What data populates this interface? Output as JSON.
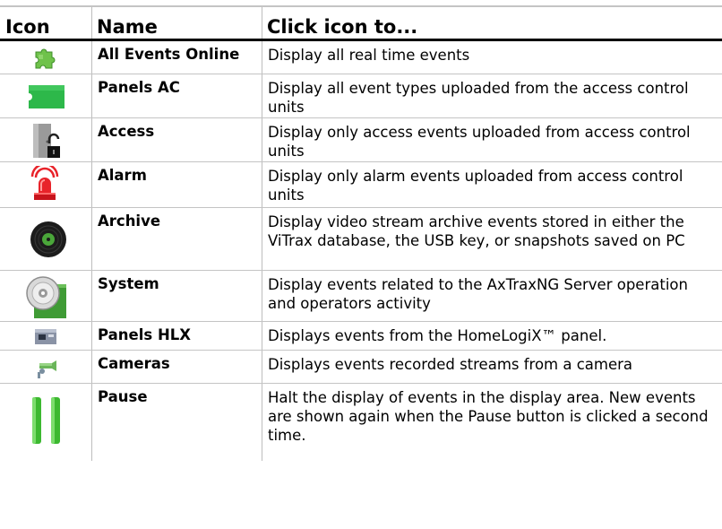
{
  "table": {
    "headers": {
      "icon": "Icon",
      "name": "Name",
      "action": "Click icon to..."
    },
    "rows": [
      {
        "icon": "puzzle-piece-icon",
        "name": "All Events Online",
        "description": "Display all real time events"
      },
      {
        "icon": "green-tag-icon",
        "name": "Panels AC",
        "description": "Display all event types uploaded from the access control units"
      },
      {
        "icon": "door-padlock-icon",
        "name": "Access",
        "description": "Display only access events uploaded from access control units"
      },
      {
        "icon": "alarm-siren-icon",
        "name": "Alarm",
        "description": "Display only alarm events uploaded from access control units"
      },
      {
        "icon": "disc-archive-icon",
        "name": "Archive",
        "description": "Display video stream archive events stored in either the ViTrax database, the USB key, or snapshots saved on PC"
      },
      {
        "icon": "system-cd-icon",
        "name": "System",
        "description": "Display events related to the AxTraxNG Server operation and operators activity"
      },
      {
        "icon": "hlx-panel-icon",
        "name": "Panels HLX",
        "description": "Displays events from the HomeLogiX™ panel."
      },
      {
        "icon": "camera-icon",
        "name": "Cameras",
        "description": "Displays events recorded streams from a camera"
      },
      {
        "icon": "pause-icon",
        "name": "Pause",
        "description": "Halt the display of events in the display area. New events are shown again when the Pause button is clicked a second time."
      }
    ]
  },
  "colors": {
    "header_rule": "#000000",
    "grid": "#c4c4c4",
    "pause_green": "#3cb830",
    "tag_green": "#2db84a"
  }
}
